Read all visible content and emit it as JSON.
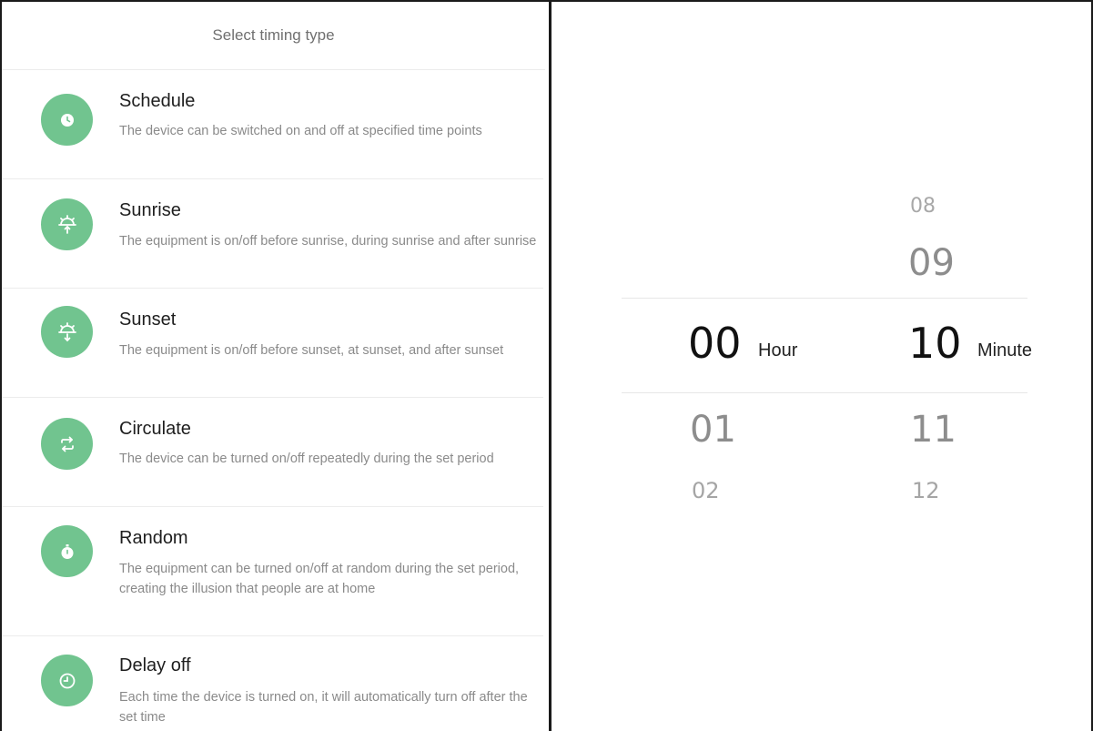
{
  "panel_title": "Select timing type",
  "items": [
    {
      "title": "Schedule",
      "desc": "The device can be switched on and off at specified time points",
      "icon": "clock-icon"
    },
    {
      "title": "Sunrise",
      "desc": "The equipment is on/off before sunrise, during sunrise and after sunrise",
      "icon": "sunrise-icon"
    },
    {
      "title": "Sunset",
      "desc": "The equipment is on/off before sunset, at sunset, and after sunset",
      "icon": "sunset-icon"
    },
    {
      "title": "Circulate",
      "desc": "The device can be turned on/off repeatedly during the set period",
      "icon": "repeat-icon"
    },
    {
      "title": "Random",
      "desc": "The equipment can be turned on/off at random during the set period, creating the illusion that people are at home",
      "icon": "stopwatch-icon"
    },
    {
      "title": "Delay off",
      "desc": "Each time the device is turned on, it will automatically turn off after the set time",
      "icon": "timer-icon"
    }
  ],
  "accent_color": "#71c48f",
  "picker": {
    "hour": {
      "above2": "",
      "above1": "",
      "selected": "00",
      "below1": "01",
      "below2": "02",
      "unit": "Hour"
    },
    "minute": {
      "above2": "08",
      "above1": "09",
      "selected": "10",
      "below1": "11",
      "below2": "12",
      "unit": "Minute"
    }
  }
}
